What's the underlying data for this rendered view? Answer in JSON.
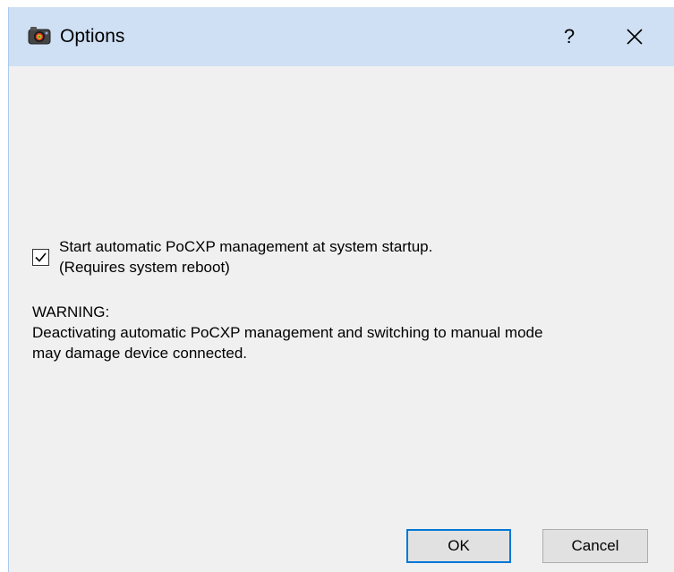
{
  "window": {
    "title": "Options",
    "help_glyph": "?"
  },
  "option": {
    "checked": true,
    "label_line1": "Start automatic PoCXP management at system startup.",
    "label_line2": "(Requires system reboot)"
  },
  "warning": {
    "heading": "WARNING:",
    "line1": "Deactivating automatic PoCXP management and switching to manual mode",
    "line2": "may damage device connected."
  },
  "buttons": {
    "ok_label": "OK",
    "cancel_label": "Cancel"
  },
  "icons": {
    "app": "camera-icon",
    "help": "help-icon",
    "close": "close-icon",
    "check": "checkmark-icon"
  },
  "colors": {
    "titlebar": "#cfe0f4",
    "dialog_background": "#f0f0f0",
    "default_button_border": "#0078d7"
  }
}
